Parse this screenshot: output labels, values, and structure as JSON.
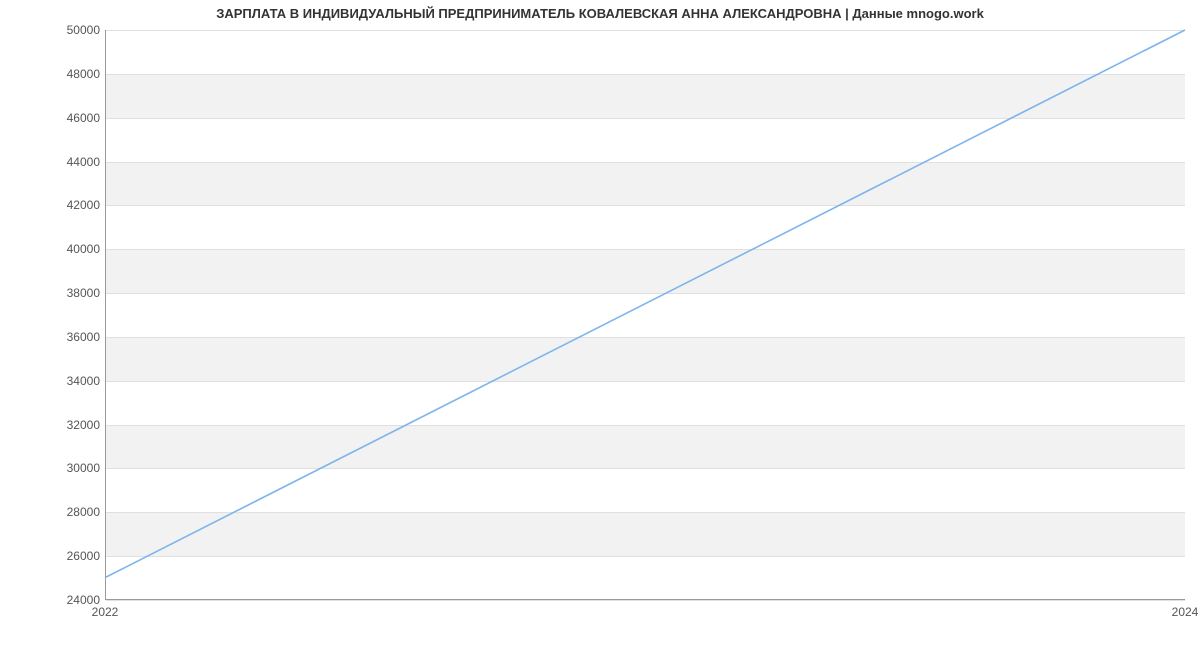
{
  "chart_data": {
    "type": "line",
    "title": "ЗАРПЛАТА В ИНДИВИДУАЛЬНЫЙ ПРЕДПРИНИМАТЕЛЬ КОВАЛЕВСКАЯ АННА АЛЕКСАНДРОВНА | Данные mnogo.work",
    "x": [
      2022,
      2024
    ],
    "values": [
      25000,
      50000
    ],
    "x_ticks": [
      2022,
      2024
    ],
    "y_ticks": [
      24000,
      26000,
      28000,
      30000,
      32000,
      34000,
      36000,
      38000,
      40000,
      42000,
      44000,
      46000,
      48000,
      50000
    ],
    "xlim": [
      2022,
      2024
    ],
    "ylim": [
      24000,
      50000
    ],
    "xlabel": "",
    "ylabel": "",
    "line_color": "#7cb5ec",
    "band_color": "#f2f2f2"
  }
}
